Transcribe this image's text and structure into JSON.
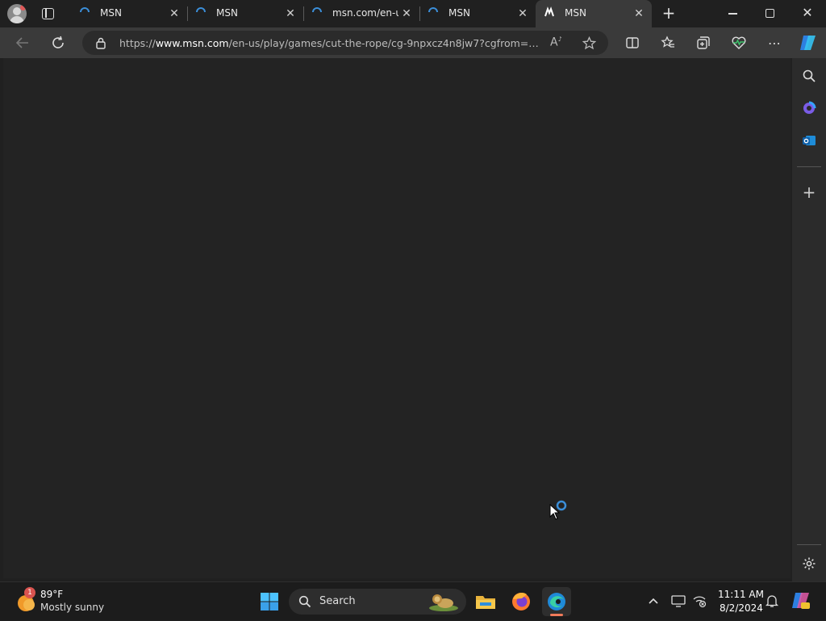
{
  "browser": {
    "tabs": [
      {
        "label": "MSN",
        "state": "loading"
      },
      {
        "label": "MSN",
        "state": "loading"
      },
      {
        "label": "msn.com/en-u",
        "state": "loading"
      },
      {
        "label": "MSN",
        "state": "loading"
      },
      {
        "label": "MSN",
        "state": "active"
      }
    ],
    "address": {
      "prefix": "https://",
      "host": "www.msn.com",
      "path": "/en-us/play/games/cut-the-rope/cg-9npxcz4n8jw7?cgfrom=c..."
    },
    "read_aloud_label": "A",
    "colors": {
      "accent": "#3b8ed8",
      "background": "#202020",
      "toolbar": "#3a3a3a"
    }
  },
  "taskbar": {
    "weather": {
      "temp": "89°F",
      "desc": "Mostly sunny",
      "badge": "1"
    },
    "search_label": "Search",
    "clock": {
      "time": "11:11 AM",
      "date": "8/2/2024"
    }
  }
}
